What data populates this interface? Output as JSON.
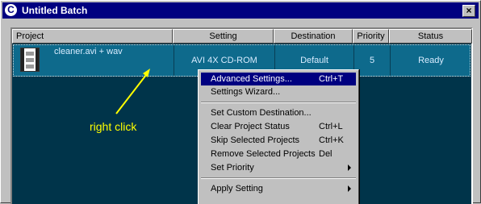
{
  "window": {
    "title": "Untitled Batch"
  },
  "columns": [
    "Project",
    "Setting",
    "Destination",
    "Priority",
    "Status"
  ],
  "rows": [
    {
      "project": "cleaner.avi + wav",
      "setting": "AVI 4X CD-ROM",
      "destination": "Default",
      "priority": "5",
      "status": "Ready"
    }
  ],
  "annotation": "right click",
  "context_menu": [
    {
      "label": "Advanced Settings...",
      "shortcut": "Ctrl+T",
      "highlighted": true
    },
    {
      "label": "Settings Wizard...",
      "shortcut": ""
    },
    {
      "label": "Set Custom Destination...",
      "shortcut": ""
    },
    {
      "label": "Clear Project Status",
      "shortcut": "Ctrl+L"
    },
    {
      "label": "Skip Selected Projects",
      "shortcut": "Ctrl+K"
    },
    {
      "label": "Remove Selected Projects",
      "shortcut": "Del"
    },
    {
      "label": "Set Priority",
      "shortcut": "",
      "submenu": true
    },
    {
      "label": "Apply Setting",
      "shortcut": "",
      "submenu": true
    }
  ],
  "colors": {
    "title_bar": "#000080",
    "list_bg": "#00344a",
    "row_selected": "#0e6a8c",
    "annotation": "#ffff00"
  },
  "icons": {
    "app": "cleaner-app-icon",
    "close": "close-icon",
    "project": "film-strip-icon",
    "arrow": "yellow-arrow-icon"
  }
}
